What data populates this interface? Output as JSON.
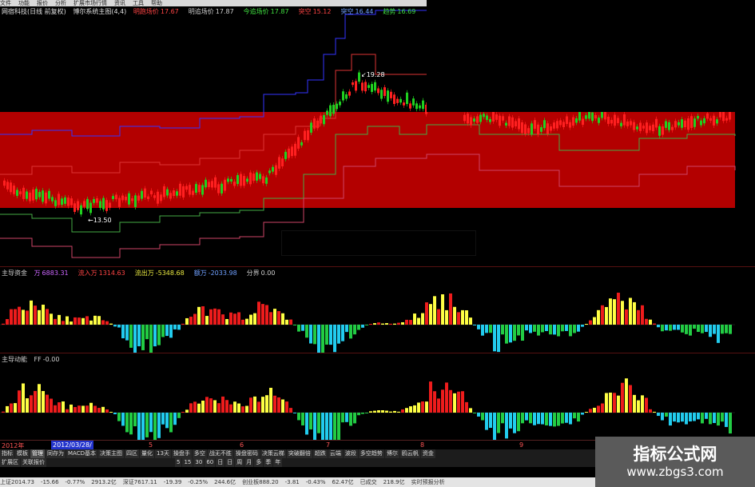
{
  "menu": {
    "items": [
      "文件",
      "功能",
      "报价",
      "分析",
      "扩展市场行情",
      "资讯",
      "工具",
      "帮助"
    ]
  },
  "main_chart": {
    "header": {
      "title": "网宿科技(日线 前复权)",
      "formula": "博尔系统主图(4,4)",
      "items": [
        {
          "label": "明跑场价",
          "value": "17.67",
          "color": "#ff4444"
        },
        {
          "label": "明追场价",
          "value": "17.87",
          "color": "#cfcfcf"
        },
        {
          "label": "今追场价",
          "value": "17.87",
          "color": "#40e040"
        },
        {
          "label": "突空",
          "value": "15.12",
          "color": "#ff4444"
        },
        {
          "label": "突空",
          "value": "16.44",
          "color": "#6fa0ff"
        },
        {
          "label": "趋势",
          "value": "16.69",
          "color": "#40e040"
        }
      ]
    },
    "high_marker": "19.28",
    "low_marker": "13.50"
  },
  "fund_panel": {
    "title": "主导资金",
    "items": [
      {
        "label": "万",
        "value": "6883.31",
        "color": "#cc66ff"
      },
      {
        "label": "流入万",
        "value": "1314.63",
        "color": "#ff4444"
      },
      {
        "label": "流出万",
        "value": "-5348.68",
        "color": "#e8e840"
      },
      {
        "label": "额万",
        "value": "-2033.98",
        "color": "#6fa0ff"
      },
      {
        "label": "分界",
        "value": "0.00",
        "color": "#cfcfcf"
      }
    ]
  },
  "energy_panel": {
    "title": "主导动能",
    "items": [
      {
        "label": "FF",
        "value": "-0.00",
        "color": "#cfcfcf"
      }
    ]
  },
  "date_axis": {
    "cursor": "2012/03/28/",
    "year": "2012年",
    "labels": [
      "5",
      "6",
      "7",
      "8",
      "9"
    ]
  },
  "tabs": [
    "指标",
    "模板",
    "管理",
    "同存为",
    "MACD基本",
    "决策主图",
    "四区",
    "量化",
    "13天",
    "操盘手",
    "多空",
    "战无不胜",
    "操盘密码",
    "决策云梯",
    "突破翻倍",
    "超跌",
    "云端",
    "波段",
    "多空趋势",
    "博尔",
    "鸥云帆",
    "资金"
  ],
  "tabs_row2": [
    "扩展区",
    "关联报价"
  ],
  "periods": [
    "5",
    "15",
    "30",
    "60",
    "日",
    "日",
    "周",
    "月",
    "多",
    "季",
    "年"
  ],
  "statusbar": [
    "上证2014.73",
    "-15.66",
    "-0.77%",
    "2913.2亿",
    "深证7617.11",
    "-19.39",
    "-0.25%",
    "244.6亿",
    "创业板888.20",
    "-3.81",
    "-0.43%",
    "62.47亿",
    "已成交",
    "218.9亿",
    "实时预报分析"
  ],
  "watermark": {
    "title": "指标公式网",
    "url": "www.zbgs3.com"
  },
  "colors": {
    "band_fill": "#b30000",
    "up": "#ff2020",
    "down": "#20d020",
    "upper_band": "#3333ff",
    "mid_band": "#dd3333",
    "lower_band": "#44aa44"
  }
}
